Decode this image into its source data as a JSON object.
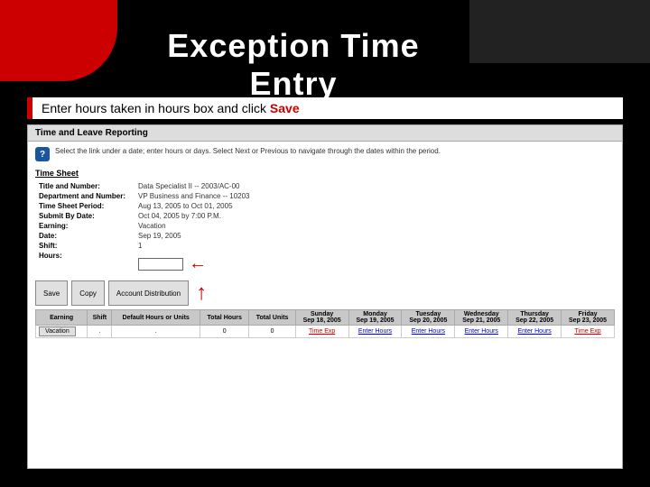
{
  "slide": {
    "title": "Exception Time Entry",
    "subtitle": "Enter hours taken in hours box and click Save"
  },
  "content": {
    "header": "Time and Leave Reporting",
    "instruction": "Select the link under a date; enter hours or days. Select Next or Previous to navigate through the dates within the period.",
    "section_title": "Time Sheet",
    "fields": [
      {
        "label": "Title and Number:",
        "value": "Data Specialist II -- 2003/AC-00"
      },
      {
        "label": "Department and Number:",
        "value": "VP Business and Finance -- 10203"
      },
      {
        "label": "Time Sheet Period:",
        "value": "Aug 13, 2005 to Oct 01, 2005"
      },
      {
        "label": "Submit By Date:",
        "value": "Oct 04, 2005 by 7:00 P.M."
      },
      {
        "label": "Earning:",
        "value": "Vacation"
      },
      {
        "label": "Date:",
        "value": "Sep 19, 2005"
      },
      {
        "label": "Shift:",
        "value": "1"
      },
      {
        "label": "Hours:",
        "value": ""
      }
    ],
    "buttons": [
      "Save",
      "Copy",
      "Account Distribution"
    ],
    "table": {
      "headers": [
        "Earning",
        "Shift",
        "Default Hours or Units",
        "Total Hours",
        "Total Units",
        "Sunday Sep 18, 2005",
        "Monday Sep 19, 2005",
        "Tuesday Sep 20, 2005",
        "Wednesday Sep 21, 2005",
        "Thursday Sep 22, 2005",
        "Friday Sep 23, 2005"
      ],
      "rows": [
        {
          "earning": "Vacation",
          "shift": ".",
          "default_hours": ".",
          "total_hours": "0",
          "total_units": "0",
          "sun": "Time Exp",
          "mon": "Enter Hours",
          "tue": "Enter Hours",
          "wed": "Enter Hours",
          "thu": "Enter Hours",
          "fri": "Time Exp"
        }
      ]
    }
  },
  "colors": {
    "red": "#cc0000",
    "blue": "#1a56a0",
    "link_blue": "#0000cc"
  }
}
